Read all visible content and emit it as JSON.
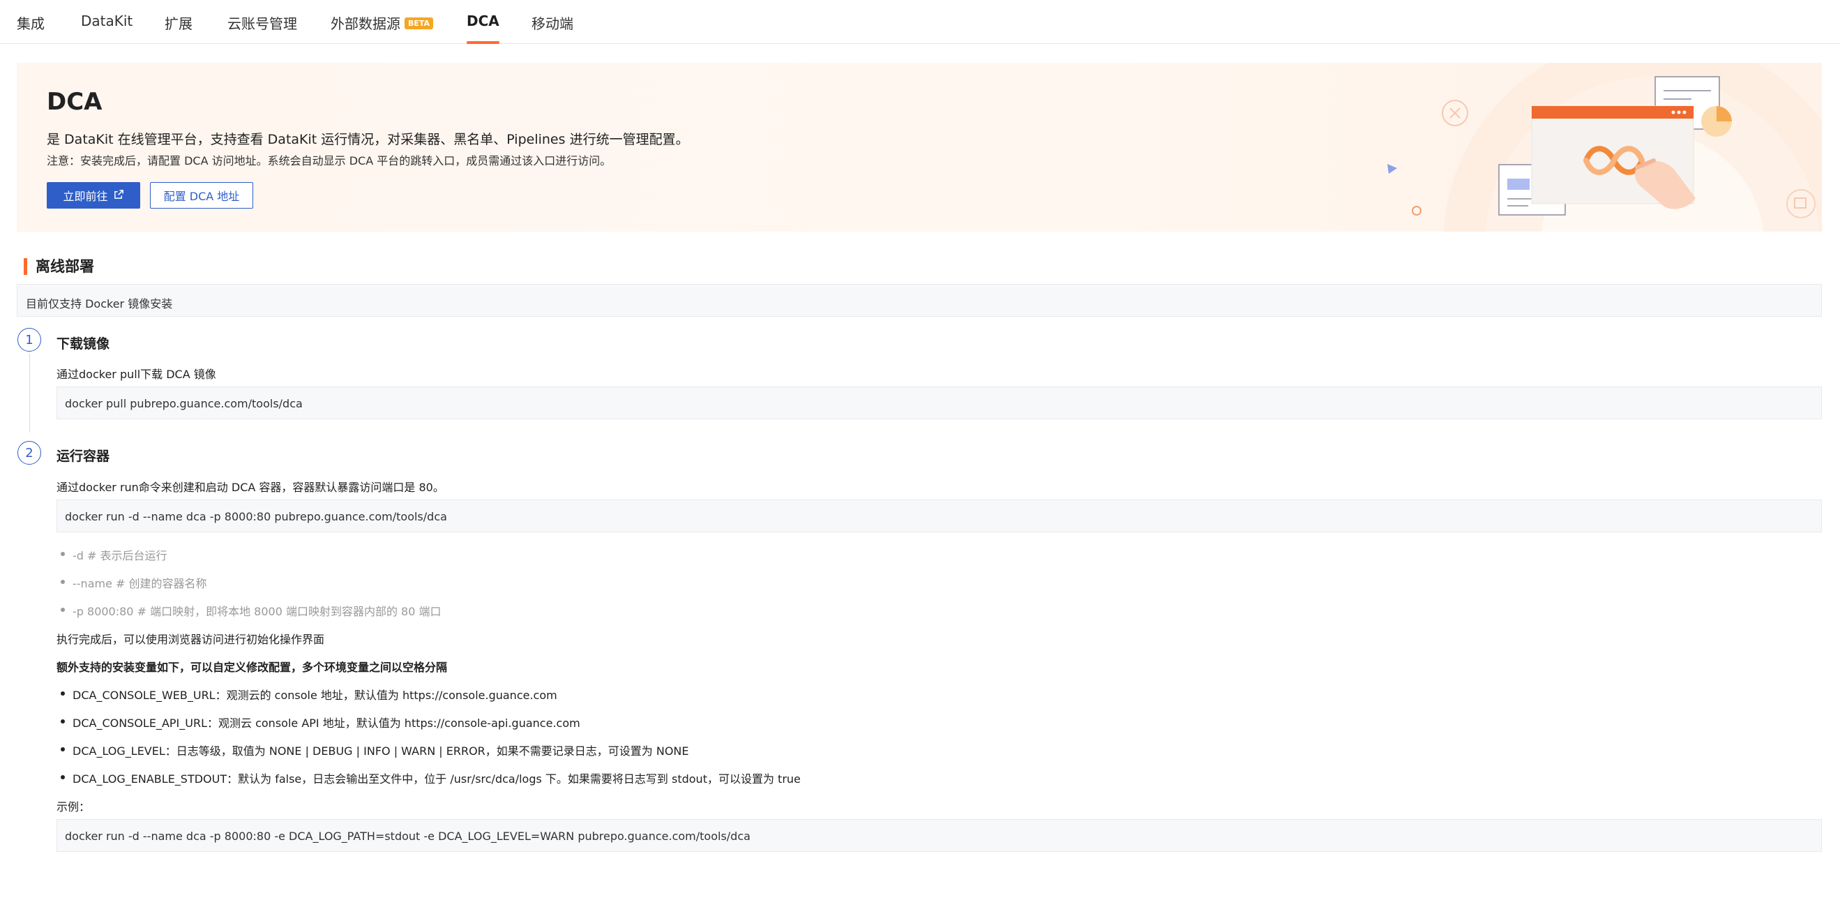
{
  "tabs": [
    {
      "label": "集成"
    },
    {
      "label": "DataKit"
    },
    {
      "label": "扩展"
    },
    {
      "label": "云账号管理"
    },
    {
      "label": "外部数据源",
      "badge": "BETA"
    },
    {
      "label": "DCA",
      "active": true
    },
    {
      "label": "移动端"
    }
  ],
  "banner": {
    "title": "DCA",
    "description": "是 DataKit 在线管理平台，支持查看 DataKit 运行情况，对采集器、黑名单、Pipelines 进行统一管理配置。",
    "note": "注意：安装完成后，请配置 DCA 访问地址。系统会自动显示 DCA 平台的跳转入口，成员需通过该入口进行访问。",
    "go_button": "立即前往",
    "config_button": "配置 DCA 地址"
  },
  "offline": {
    "title": "离线部署",
    "info": "目前仅支持 Docker 镜像安装",
    "step1": {
      "number": "1",
      "title": "下载镜像",
      "desc": "通过docker pull下载 DCA 镜像",
      "code": "docker pull pubrepo.guance.com/tools/dca"
    },
    "step2": {
      "number": "2",
      "title": "运行容器",
      "desc": "通过docker run命令来创建和启动 DCA 容器，容器默认暴露访问端口是 80。",
      "code": "docker run -d --name dca -p 8000:80 pubrepo.guance.com/tools/dca",
      "options": [
        "-d # 表示后台运行",
        "--name # 创建的容器名称",
        "-p 8000:80 # 端口映射，即将本地 8000 端口映射到容器内部的 80 端口"
      ],
      "after": "执行完成后，可以使用浏览器访问进行初始化操作界面",
      "env_title": "额外支持的安装变量如下，可以自定义修改配置，多个环境变量之间以空格分隔",
      "env_vars": [
        "DCA_CONSOLE_WEB_URL：观测云的 console 地址，默认值为 https://console.guance.com",
        "DCA_CONSOLE_API_URL：观测云 console API 地址，默认值为 https://console-api.guance.com",
        "DCA_LOG_LEVEL：日志等级，取值为 NONE | DEBUG | INFO | WARN | ERROR，如果不需要记录日志，可设置为 NONE",
        "DCA_LOG_ENABLE_STDOUT：默认为 false，日志会输出至文件中，位于 /usr/src/dca/logs 下。如果需要将日志写到 stdout，可以设置为 true"
      ],
      "example_label": "示例：",
      "example_code": "docker run -d --name dca -p 8000:80 -e DCA_LOG_PATH=stdout -e DCA_LOG_LEVEL=WARN pubrepo.guance.com/tools/dca"
    }
  },
  "colors": {
    "accent": "#ff6a2c",
    "primary": "#2f5ec8",
    "beta": "#f5a623"
  },
  "icons": [
    "external-link-icon",
    "banner-illustration"
  ]
}
